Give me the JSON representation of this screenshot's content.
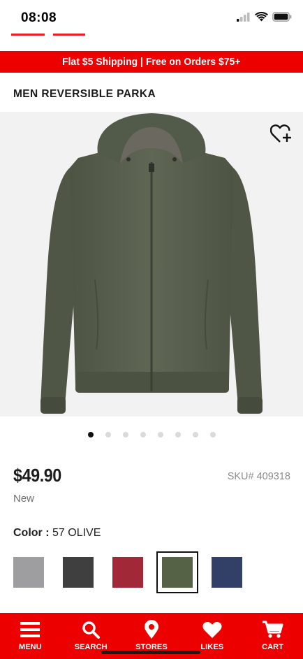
{
  "status_bar": {
    "time": "08:08"
  },
  "promo": {
    "text": "Flat $5 Shipping | Free on Orders $75+"
  },
  "product": {
    "title": "MEN REVERSIBLE PARKA",
    "price": "$49.90",
    "sku": "SKU# 409318",
    "condition": "New",
    "image_count": 8,
    "active_image": 1
  },
  "color": {
    "label": "Color :",
    "selected": "57 OLIVE",
    "swatches": [
      {
        "hex": "#9e9d9f"
      },
      {
        "hex": "#3f3f3f"
      },
      {
        "hex": "#a12837"
      },
      {
        "hex": "#566246",
        "selected": true
      },
      {
        "hex": "#324068"
      }
    ]
  },
  "bottom_nav": {
    "items": [
      {
        "label": "MENU",
        "icon": "menu-icon"
      },
      {
        "label": "SEARCH",
        "icon": "search-icon"
      },
      {
        "label": "STORES",
        "icon": "location-pin-icon"
      },
      {
        "label": "LIKES",
        "icon": "heart-icon"
      },
      {
        "label": "CART",
        "icon": "cart-icon"
      }
    ]
  },
  "colors": {
    "brand_red": "#ed0000",
    "jacket_olive": "#5a6150"
  }
}
